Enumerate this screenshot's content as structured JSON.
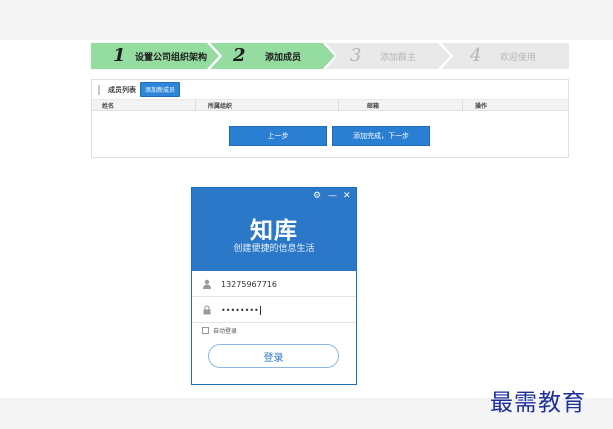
{
  "wizard": {
    "steps": [
      {
        "num": "1",
        "label": "设置公司组织架构",
        "state": "active"
      },
      {
        "num": "2",
        "label": "添加成员",
        "state": "active"
      },
      {
        "num": "3",
        "label": "添加群主",
        "state": "inactive"
      },
      {
        "num": "4",
        "label": "欢迎使用",
        "state": "inactive"
      }
    ],
    "colors": {
      "active": "#95dca0",
      "inactive": "#e9e9e9"
    }
  },
  "panel": {
    "title": "成员列表",
    "add_member_label": "添加新成员",
    "columns": [
      "姓名",
      "所属组织",
      "邮箱",
      "操作"
    ],
    "prev_label": "上一步",
    "next_label": "添加完成，下一步"
  },
  "login": {
    "brand": "知库",
    "slogan": "创建便捷的信息生活",
    "username_value": "13275967716",
    "password_value": "••••••••",
    "remember_label": "自动登录",
    "login_label": "登录",
    "controls": {
      "settings": "⚙",
      "minimize": "—",
      "close": "✕"
    },
    "accent": "#2b78c8"
  },
  "watermark": "最需教育"
}
